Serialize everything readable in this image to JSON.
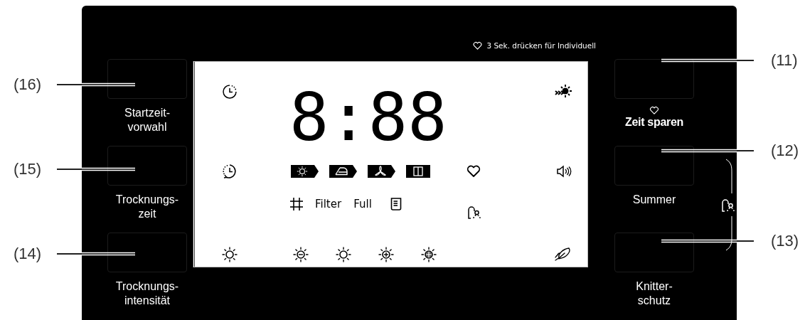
{
  "panel": {
    "hint": "3 Sek. drücken für Individuell",
    "left_buttons": [
      {
        "label": "Startzeit-\nvorwahl",
        "kind": "plain"
      },
      {
        "label": "Trocknungs-\nzeit",
        "kind": "plain"
      },
      {
        "label": "Trocknungs-\nintensität",
        "kind": "plain"
      }
    ],
    "display": {
      "digits": "8:88",
      "indicators": [
        "Filter",
        "Full"
      ]
    },
    "right_buttons": [
      {
        "label": "Zeit sparen",
        "kind": "favorite"
      },
      {
        "label": "Summer",
        "kind": "plain"
      },
      {
        "label": "Knitter-\nschutz",
        "kind": "plain"
      }
    ]
  },
  "callouts_left": [
    "(16)",
    "(15)",
    "(14)"
  ],
  "callouts_right": [
    "(11)",
    "(12)",
    "(13)"
  ]
}
